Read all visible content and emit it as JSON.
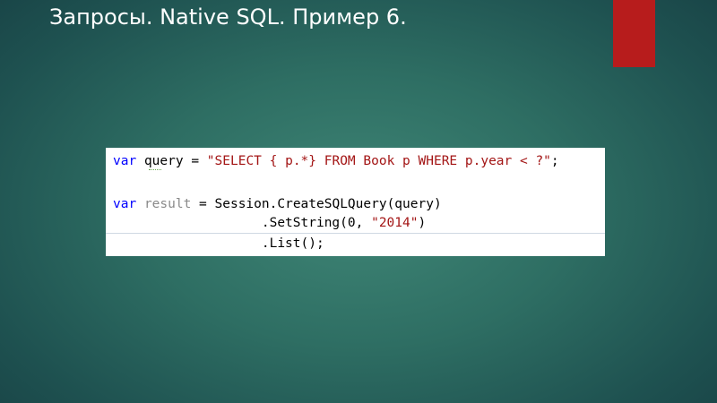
{
  "slide": {
    "title": "Запросы. Native SQL. Пример 6.",
    "accent_color": "#b71c1c"
  },
  "code": {
    "line1": {
      "kw": "var",
      "ident": "query",
      "op": " = ",
      "str": "\"SELECT { p.*} FROM Book p WHERE p.year < ?\"",
      "end": ";"
    },
    "line3": {
      "kw": "var",
      "ident": "result",
      "rest": " = Session.CreateSQLQuery(query)"
    },
    "line4": {
      "pre": "                   .SetString(0, ",
      "str": "\"2014\"",
      "end": ")"
    },
    "line5": {
      "text": "                   .List();"
    }
  }
}
